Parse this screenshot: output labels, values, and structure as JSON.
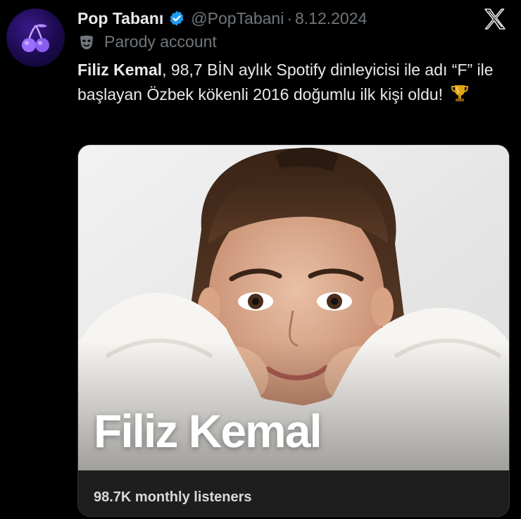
{
  "tweet": {
    "display_name": "Pop Tabanı",
    "handle": "@PopTabani",
    "separator": "·",
    "date": "8.12.2024",
    "account_label": "Parody account",
    "text_bold": "Filiz Kemal",
    "text_rest": ", 98,7 BİN aylık Spotify dinleyicisi ile adı “F” ile başlayan Özbek kökenli 2016 doğumlu ilk kişi oldu!",
    "emoji": "trophy-icon"
  },
  "card": {
    "artist_name": "Filiz Kemal",
    "monthly_listeners": "98.7K monthly listeners"
  },
  "colors": {
    "background": "#000000",
    "text": "#e7e9ea",
    "muted": "#71767b",
    "verified": "#1d9bf0"
  }
}
